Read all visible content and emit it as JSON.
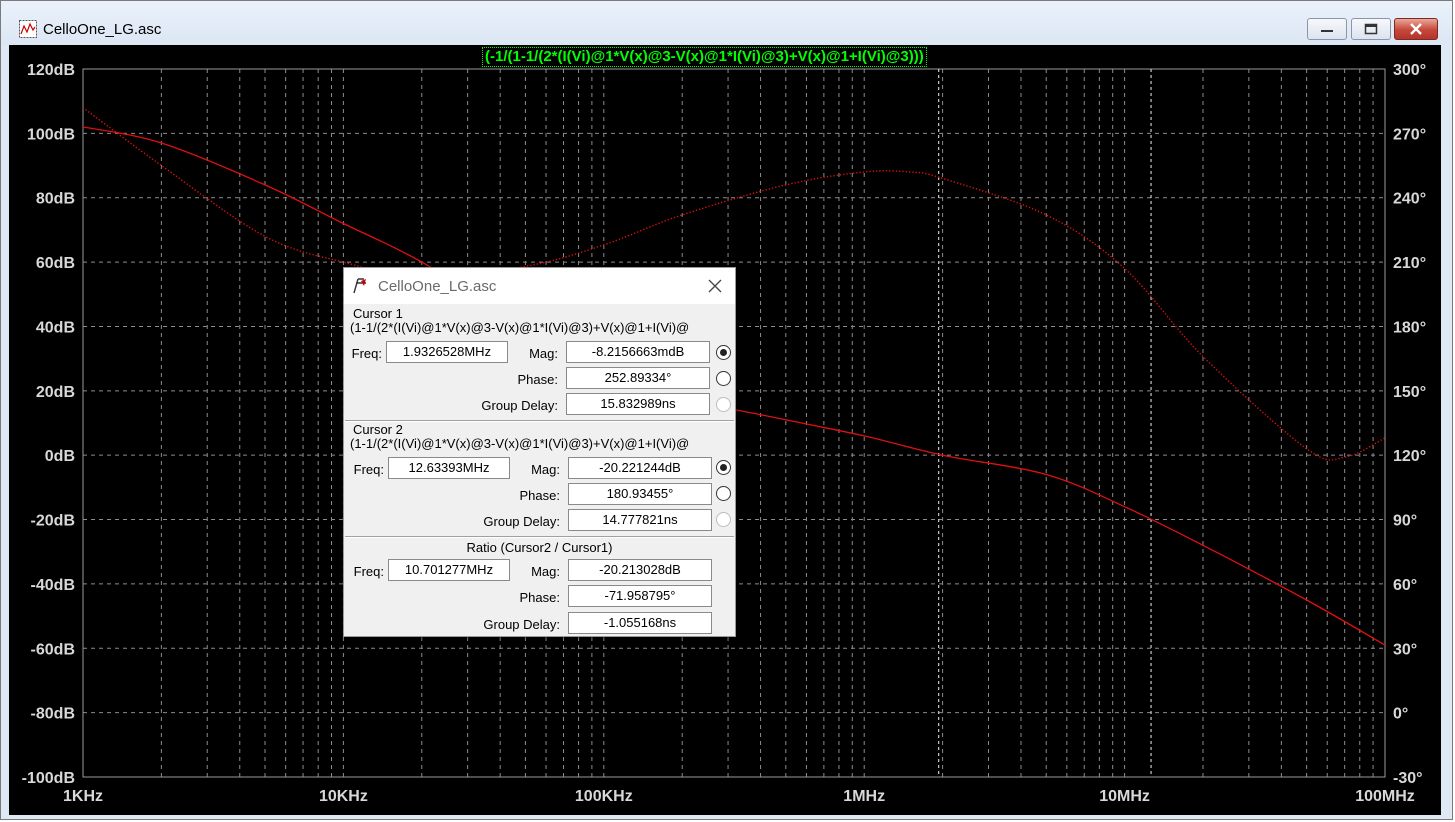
{
  "window": {
    "title": "CelloOne_LG.asc",
    "expression": "(-1/(1-1/(2*(I(Vi)@1*V(x)@3-V(x)@1*I(Vi)@3)+V(x)@1+I(Vi)@3)))"
  },
  "colors": {
    "plot_bg": "#000000",
    "grid": "#8c8c8c",
    "trace": "#e01010",
    "expression": "#00ff00",
    "axis_text": "#d8d8d8"
  },
  "chart_data": {
    "type": "line",
    "xscale": "log",
    "xlim": [
      1000,
      100000000
    ],
    "ylim_left": [
      -100,
      120
    ],
    "ylim_right": [
      -30,
      300
    ],
    "x_tick_labels": [
      "1KHz",
      "10KHz",
      "100KHz",
      "1MHz",
      "10MHz",
      "100MHz"
    ],
    "y_left_tick_labels": [
      "120dB",
      "100dB",
      "80dB",
      "60dB",
      "40dB",
      "20dB",
      "0dB",
      "-20dB",
      "-40dB",
      "-60dB",
      "-80dB",
      "-100dB"
    ],
    "y_right_tick_labels": [
      "300°",
      "270°",
      "240°",
      "210°",
      "180°",
      "150°",
      "120°",
      "90°",
      "60°",
      "30°",
      "0°",
      "-30°"
    ],
    "grid": true,
    "cursors_x": [
      1932652.8,
      12633930
    ],
    "series": [
      {
        "style": "solid",
        "axis": "left",
        "x": [
          1000,
          2000,
          5000,
          10000,
          20000,
          50000,
          100000,
          200000,
          500000,
          1000000,
          2000000,
          5000000,
          10000000,
          20000000,
          50000000,
          100000000
        ],
        "y": [
          102,
          97,
          84,
          72,
          60,
          40,
          28,
          18,
          11,
          6,
          0,
          -6,
          -16,
          -28,
          -45,
          -59
        ]
      },
      {
        "style": "dotted",
        "axis": "right",
        "x": [
          1000,
          2000,
          5000,
          10000,
          20000,
          50000,
          100000,
          200000,
          500000,
          1000000,
          1500000,
          2000000,
          5000000,
          10000000,
          20000000,
          50000000,
          70000000,
          100000000
        ],
        "y": [
          282,
          255,
          222,
          210,
          203,
          208,
          218,
          232,
          246,
          252,
          252,
          249,
          232,
          207,
          166,
          123,
          119,
          128
        ]
      }
    ]
  },
  "dialog": {
    "title": "CelloOne_LG.asc",
    "cursor1": {
      "title": "Cursor 1",
      "expr": "(1-1/(2*(I(Vi)@1*V(x)@3-V(x)@1*I(Vi)@3)+V(x)@1+I(Vi)@",
      "freq_label": "Freq:",
      "freq": "1.9326528MHz",
      "mag_label": "Mag:",
      "mag": "-8.2156663mdB",
      "phase_label": "Phase:",
      "phase": "252.89334°",
      "gd_label": "Group Delay:",
      "gd": "15.832989ns"
    },
    "cursor2": {
      "title": "Cursor 2",
      "expr": "(1-1/(2*(I(Vi)@1*V(x)@3-V(x)@1*I(Vi)@3)+V(x)@1+I(Vi)@",
      "freq_label": "Freq:",
      "freq": "12.63393MHz",
      "mag_label": "Mag:",
      "mag": "-20.221244dB",
      "phase_label": "Phase:",
      "phase": "180.93455°",
      "gd_label": "Group Delay:",
      "gd": "14.777821ns"
    },
    "ratio": {
      "title": "Ratio (Cursor2 / Cursor1)",
      "freq_label": "Freq:",
      "freq": "10.701277MHz",
      "mag_label": "Mag:",
      "mag": "-20.213028dB",
      "phase_label": "Phase:",
      "phase": "-71.958795°",
      "gd_label": "Group Delay:",
      "gd": "-1.055168ns"
    }
  }
}
